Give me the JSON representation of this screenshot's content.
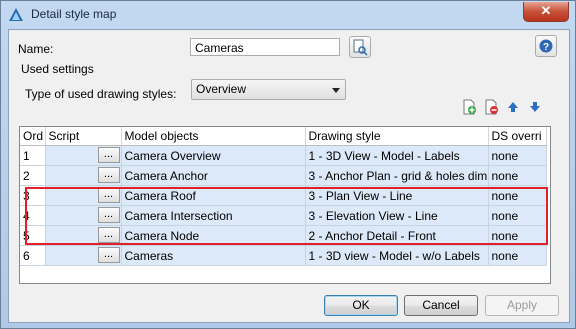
{
  "window": {
    "title": "Detail style map",
    "close_label": "✕"
  },
  "form": {
    "name_label": "Name:",
    "name_value": "Cameras",
    "used_settings_label": "Used settings",
    "type_label": "Type of used drawing styles:",
    "type_value": "Overview"
  },
  "grid": {
    "columns": [
      "Ord",
      "Script",
      "Model objects",
      "Drawing style",
      "DS overri"
    ],
    "rows": [
      {
        "ord": "1",
        "script": "...",
        "model": "Camera Overview",
        "style": "1 - 3D View - Model - Labels",
        "ds": "none"
      },
      {
        "ord": "2",
        "script": "...",
        "model": "Camera Anchor",
        "style": "3 - Anchor Plan - grid & holes dim",
        "ds": "none"
      },
      {
        "ord": "3",
        "script": "...",
        "model": "Camera Roof",
        "style": "3 - Plan View - Line",
        "ds": "none"
      },
      {
        "ord": "4",
        "script": "...",
        "model": "Camera Intersection",
        "style": "3 - Elevation View - Line",
        "ds": "none"
      },
      {
        "ord": "5",
        "script": "...",
        "model": "Camera Node",
        "style": "2 - Anchor Detail - Front",
        "ds": "none"
      },
      {
        "ord": "6",
        "script": "...",
        "model": "Cameras",
        "style": "1 - 3D view - Model - w/o Labels",
        "ds": "none"
      }
    ]
  },
  "buttons": {
    "ok": "OK",
    "cancel": "Cancel",
    "apply": "Apply"
  },
  "colors": {
    "highlight": "#e0202a",
    "row_fill": "#dce9f8"
  },
  "icons": [
    "app-icon",
    "close-icon",
    "browse-icon",
    "help-icon",
    "add-row-icon",
    "delete-row-icon",
    "move-up-icon",
    "move-down-icon"
  ]
}
